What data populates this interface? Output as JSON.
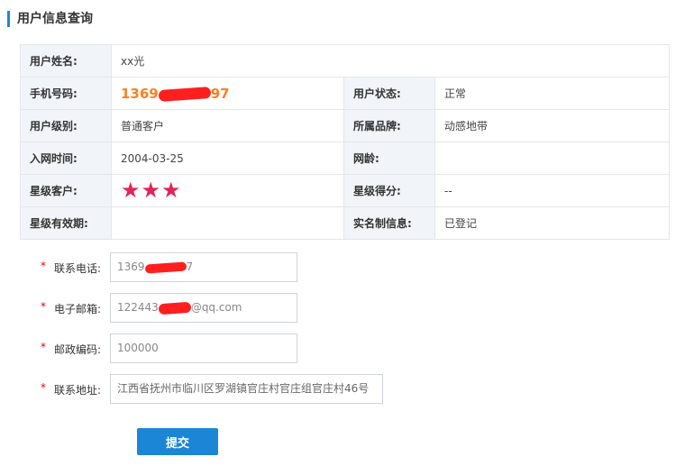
{
  "section_title": "用户信息查询",
  "info": {
    "name_label": "用户姓名:",
    "name_value": "xx光",
    "phone_label": "手机号码:",
    "phone_prefix": "1369",
    "phone_suffix": "97",
    "status_label": "用户状态:",
    "status_value": "正常",
    "level_label": "用户级别:",
    "level_value": "普通客户",
    "brand_label": "所属品牌:",
    "brand_value": "动感地带",
    "join_label": "入网时间:",
    "join_value": "2004-03-25",
    "age_label": "网龄:",
    "age_value": "",
    "star_label": "星级客户:",
    "star_count": 3,
    "star_glyphs": "★★★",
    "score_label": "星级得分:",
    "score_value": "--",
    "star_valid_label": "星级有效期:",
    "star_valid_value": "",
    "realname_label": "实名制信息:",
    "realname_value": "已登记"
  },
  "form": {
    "phone": {
      "label": "联系电话:",
      "prefix": "1369",
      "suffix": "7"
    },
    "email": {
      "label": "电子邮箱:",
      "prefix": "122443",
      "suffix": "@qq.com"
    },
    "postcode": {
      "label": "邮政编码:",
      "value": "100000"
    },
    "address": {
      "label": "联系地址:",
      "value": "江西省抚州市临川区罗湖镇官庄村官庄组官庄村46号"
    },
    "required_mark": "*"
  },
  "submit_label": "提交",
  "colors": {
    "accent": "#1e88d9",
    "phone_highlight": "#ff7f1e",
    "star": "#e2245a",
    "redaction": "#ff1f1f",
    "required": "#e60000",
    "button": "#1c86d6"
  }
}
